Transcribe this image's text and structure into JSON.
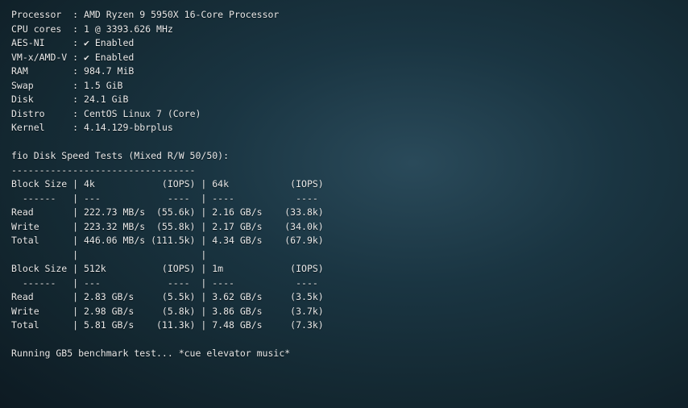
{
  "sysinfo": {
    "processor_label": "Processor  : ",
    "processor_value": "AMD Ryzen 9 5950X 16-Core Processor",
    "cpucores_label": "CPU cores  : ",
    "cpucores_value": "1 @ 3393.626 MHz",
    "aesni_label": "AES-NI     : ",
    "aesni_value": "✔ Enabled",
    "vmx_label": "VM-x/AMD-V : ",
    "vmx_value": "✔ Enabled",
    "ram_label": "RAM        : ",
    "ram_value": "984.7 MiB",
    "swap_label": "Swap       : ",
    "swap_value": "1.5 GiB",
    "disk_label": "Disk       : ",
    "disk_value": "24.1 GiB",
    "distro_label": "Distro     : ",
    "distro_value": "CentOS Linux 7 (Core)",
    "kernel_label": "Kernel     : ",
    "kernel_value": "4.14.129-bbrplus"
  },
  "fio": {
    "title": "fio Disk Speed Tests (Mixed R/W 50/50):",
    "divider": "---------------------------------",
    "header1": "Block Size | 4k            (IOPS) | 64k           (IOPS)",
    "hdrsep": "  ------   | ---            ----  | ----           ---- ",
    "read1": "Read       | 222.73 MB/s  (55.6k) | 2.16 GB/s    (33.8k)",
    "write1": "Write      | 223.32 MB/s  (55.8k) | 2.17 GB/s    (34.0k)",
    "total1": "Total      | 446.06 MB/s (111.5k) | 4.34 GB/s    (67.9k)",
    "gap": "           |                      |                     ",
    "header2": "Block Size | 512k          (IOPS) | 1m            (IOPS)",
    "hdrsep2": "  ------   | ---            ----  | ----           ---- ",
    "read2": "Read       | 2.83 GB/s     (5.5k) | 3.62 GB/s     (3.5k)",
    "write2": "Write      | 2.98 GB/s     (5.8k) | 3.86 GB/s     (3.7k)",
    "total2": "Total      | 5.81 GB/s    (11.3k) | 7.48 GB/s     (7.3k)"
  },
  "footer": {
    "line": "Running GB5 benchmark test... *cue elevator music*"
  }
}
